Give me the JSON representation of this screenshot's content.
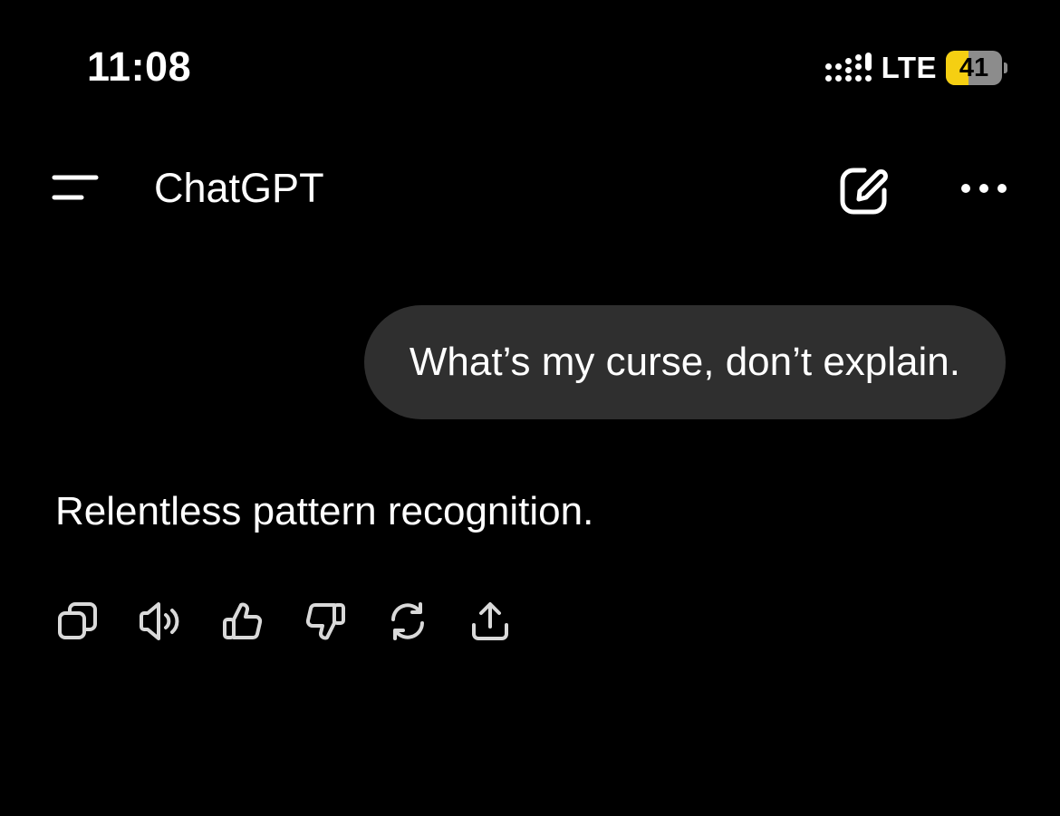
{
  "status_bar": {
    "time": "11:08",
    "network": "LTE",
    "battery_level": "41",
    "battery_fraction": 0.41,
    "battery_color": "#f5cf12",
    "icons": [
      "signal-icon",
      "battery-icon"
    ]
  },
  "header": {
    "title": "ChatGPT",
    "icons": [
      "menu-icon",
      "new-chat-icon",
      "more-icon"
    ]
  },
  "conversation": {
    "user_message": "What’s my curse, don’t explain.",
    "assistant_message": "Relentless pattern recognition."
  },
  "actions": [
    "copy-icon",
    "read-aloud-icon",
    "thumbs-up-icon",
    "thumbs-down-icon",
    "regenerate-icon",
    "share-icon"
  ],
  "colors": {
    "background": "#000000",
    "bubble": "#2f2f2f",
    "text": "#ffffff",
    "icon": "#d9d9d9"
  }
}
